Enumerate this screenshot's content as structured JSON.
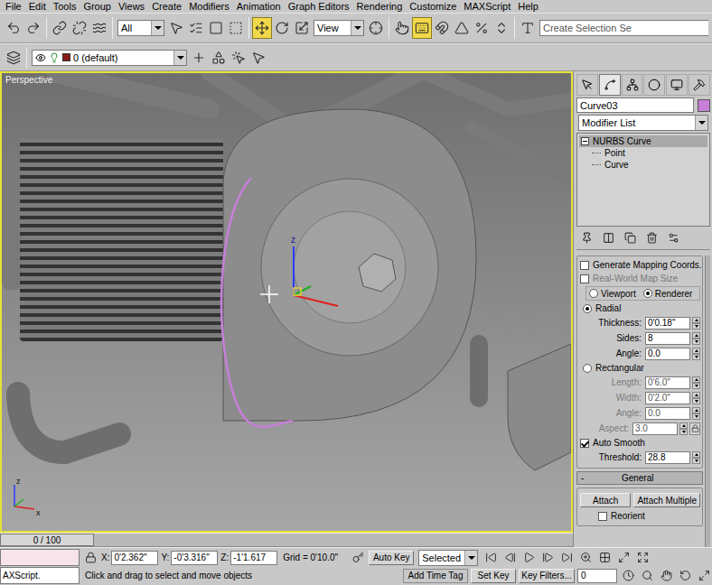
{
  "menu": [
    "File",
    "Edit",
    "Tools",
    "Group",
    "Views",
    "Create",
    "Modifiers",
    "Animation",
    "Graph Editors",
    "Rendering",
    "Customize",
    "MAXScript",
    "Help"
  ],
  "main_toolbar": {
    "history_tools": [
      {
        "active": false
      },
      {
        "active": false
      }
    ],
    "link_tools": [
      {
        "active": false
      },
      {
        "active": false
      },
      {
        "active": false
      }
    ],
    "selection_filter": "All",
    "select_tools": [
      {
        "active": false
      },
      {
        "active": false
      },
      {
        "active": false
      },
      {
        "active": false
      }
    ],
    "transform_tools": [
      {
        "active": true
      },
      {
        "active": false
      },
      {
        "active": false
      }
    ],
    "reference_coord": "View",
    "pivot_tools": [
      {
        "active": false
      }
    ],
    "snap_tools": [
      {
        "active": false
      },
      {
        "active": true
      },
      {
        "active": false
      },
      {
        "active": false
      },
      {
        "active": false
      },
      {
        "active": false
      }
    ],
    "named_set_tools": [
      {
        "active": false
      }
    ],
    "named_selection": "Create Selection Se"
  },
  "layer_toolbar": {
    "layer": "0 (default)"
  },
  "viewport": {
    "label": "Perspective",
    "active": true,
    "gizmo_labels": [
      "z"
    ],
    "triad_labels": [
      "z",
      "x"
    ]
  },
  "time_slider": {
    "label": "0 / 100",
    "level": 0
  },
  "command_panel": {
    "tabs": [
      {
        "selected": false
      },
      {
        "selected": true
      },
      {
        "selected": false
      },
      {
        "selected": false
      },
      {
        "selected": false
      },
      {
        "selected": false
      }
    ],
    "object_name": "Curve03",
    "object_color": "#c77fd8",
    "modifier_list": "Modifier List",
    "stack": [
      {
        "label": "NURBS Curve",
        "selected": true,
        "expanded": true,
        "children": [
          {
            "label": "Point",
            "selected": false
          },
          {
            "label": "Curve",
            "selected": false
          }
        ]
      }
    ],
    "rendering_rows": [
      {
        "kind": "checkbox",
        "label": "Generate Mapping Coords.",
        "checked": false,
        "disabled": false
      },
      {
        "kind": "checkbox",
        "label": "Real-World Map Size",
        "checked": false,
        "disabled": true
      },
      {
        "kind": "radio-pair",
        "options": [
          {
            "label": "Viewport",
            "selected": false
          },
          {
            "label": "Renderer",
            "selected": true
          }
        ]
      },
      {
        "kind": "radio",
        "label": "Radial",
        "selected": true
      },
      {
        "kind": "spinner",
        "label": "Thickness:",
        "value": "0'0.18\"",
        "disabled": false
      },
      {
        "kind": "spinner",
        "label": "Sides:",
        "value": "8",
        "disabled": false
      },
      {
        "kind": "spinner",
        "label": "Angle:",
        "value": "0.0",
        "disabled": false
      },
      {
        "kind": "radio",
        "label": "Rectangular",
        "selected": false
      },
      {
        "kind": "spinner",
        "label": "Length:",
        "value": "0'6.0\"",
        "disabled": true
      },
      {
        "kind": "spinner",
        "label": "Width:",
        "value": "0'2.0\"",
        "disabled": true
      },
      {
        "kind": "spinner",
        "label": "Angle:",
        "value": "0.0",
        "disabled": true
      },
      {
        "kind": "spinner",
        "label": "Aspect:",
        "value": "3.0",
        "disabled": true,
        "locked": false
      },
      {
        "kind": "checkbox",
        "label": "Auto Smooth",
        "checked": true,
        "disabled": false
      },
      {
        "kind": "spinner",
        "label": "Threshold:",
        "value": "28.8",
        "disabled": false
      }
    ],
    "general": {
      "title": "General",
      "collapse_mark": "-",
      "buttons": [
        "Attach",
        "Attach Multiple"
      ],
      "checkbox": {
        "label": "Reorient",
        "checked": false
      }
    }
  },
  "status_bar": {
    "listener": "AXScript.",
    "coords": [
      {
        "axis": "X:",
        "value": "0'2.362\""
      },
      {
        "axis": "Y:",
        "value": "-0'3.316\""
      },
      {
        "axis": "Z:",
        "value": "-1'1.617"
      }
    ],
    "grid": "Grid = 0'10.0\"",
    "auto_key": {
      "label": "Auto Key",
      "active": false
    },
    "key_target": "Selected",
    "set_key": "Set Key",
    "key_filters": "Key Filters...",
    "prompt": "Click and drag to select and move objects",
    "time_tag": "Add Time Tag",
    "current_frame": "0"
  }
}
